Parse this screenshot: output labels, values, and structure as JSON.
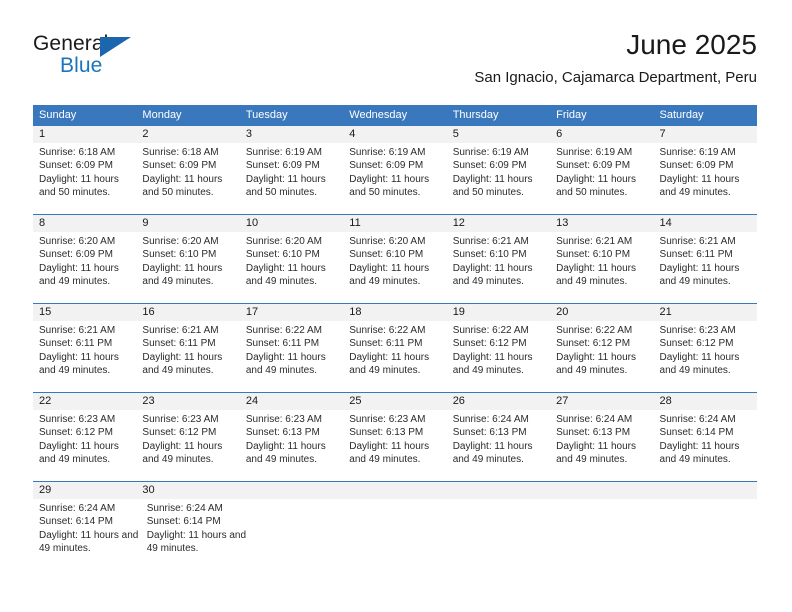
{
  "brand": {
    "name_part1": "General",
    "name_part2": "Blue",
    "flag_icon": "triangle-flag-icon",
    "accent_color": "#1c75bc"
  },
  "header": {
    "title": "June 2025",
    "subtitle": "San Ignacio, Cajamarca Department, Peru"
  },
  "theme": {
    "header_blue": "#3a78bd",
    "daynum_band_gray": "#f2f2f2",
    "text_color": "#1a1a1a"
  },
  "calendar": {
    "weekdays": [
      "Sunday",
      "Monday",
      "Tuesday",
      "Wednesday",
      "Thursday",
      "Friday",
      "Saturday"
    ],
    "weeks": [
      {
        "days": [
          {
            "num": "1",
            "sunrise": "Sunrise: 6:18 AM",
            "sunset": "Sunset: 6:09 PM",
            "daylight": "Daylight: 11 hours and 50 minutes."
          },
          {
            "num": "2",
            "sunrise": "Sunrise: 6:18 AM",
            "sunset": "Sunset: 6:09 PM",
            "daylight": "Daylight: 11 hours and 50 minutes."
          },
          {
            "num": "3",
            "sunrise": "Sunrise: 6:19 AM",
            "sunset": "Sunset: 6:09 PM",
            "daylight": "Daylight: 11 hours and 50 minutes."
          },
          {
            "num": "4",
            "sunrise": "Sunrise: 6:19 AM",
            "sunset": "Sunset: 6:09 PM",
            "daylight": "Daylight: 11 hours and 50 minutes."
          },
          {
            "num": "5",
            "sunrise": "Sunrise: 6:19 AM",
            "sunset": "Sunset: 6:09 PM",
            "daylight": "Daylight: 11 hours and 50 minutes."
          },
          {
            "num": "6",
            "sunrise": "Sunrise: 6:19 AM",
            "sunset": "Sunset: 6:09 PM",
            "daylight": "Daylight: 11 hours and 50 minutes."
          },
          {
            "num": "7",
            "sunrise": "Sunrise: 6:19 AM",
            "sunset": "Sunset: 6:09 PM",
            "daylight": "Daylight: 11 hours and 49 minutes."
          }
        ]
      },
      {
        "days": [
          {
            "num": "8",
            "sunrise": "Sunrise: 6:20 AM",
            "sunset": "Sunset: 6:09 PM",
            "daylight": "Daylight: 11 hours and 49 minutes."
          },
          {
            "num": "9",
            "sunrise": "Sunrise: 6:20 AM",
            "sunset": "Sunset: 6:10 PM",
            "daylight": "Daylight: 11 hours and 49 minutes."
          },
          {
            "num": "10",
            "sunrise": "Sunrise: 6:20 AM",
            "sunset": "Sunset: 6:10 PM",
            "daylight": "Daylight: 11 hours and 49 minutes."
          },
          {
            "num": "11",
            "sunrise": "Sunrise: 6:20 AM",
            "sunset": "Sunset: 6:10 PM",
            "daylight": "Daylight: 11 hours and 49 minutes."
          },
          {
            "num": "12",
            "sunrise": "Sunrise: 6:21 AM",
            "sunset": "Sunset: 6:10 PM",
            "daylight": "Daylight: 11 hours and 49 minutes."
          },
          {
            "num": "13",
            "sunrise": "Sunrise: 6:21 AM",
            "sunset": "Sunset: 6:10 PM",
            "daylight": "Daylight: 11 hours and 49 minutes."
          },
          {
            "num": "14",
            "sunrise": "Sunrise: 6:21 AM",
            "sunset": "Sunset: 6:11 PM",
            "daylight": "Daylight: 11 hours and 49 minutes."
          }
        ]
      },
      {
        "days": [
          {
            "num": "15",
            "sunrise": "Sunrise: 6:21 AM",
            "sunset": "Sunset: 6:11 PM",
            "daylight": "Daylight: 11 hours and 49 minutes."
          },
          {
            "num": "16",
            "sunrise": "Sunrise: 6:21 AM",
            "sunset": "Sunset: 6:11 PM",
            "daylight": "Daylight: 11 hours and 49 minutes."
          },
          {
            "num": "17",
            "sunrise": "Sunrise: 6:22 AM",
            "sunset": "Sunset: 6:11 PM",
            "daylight": "Daylight: 11 hours and 49 minutes."
          },
          {
            "num": "18",
            "sunrise": "Sunrise: 6:22 AM",
            "sunset": "Sunset: 6:11 PM",
            "daylight": "Daylight: 11 hours and 49 minutes."
          },
          {
            "num": "19",
            "sunrise": "Sunrise: 6:22 AM",
            "sunset": "Sunset: 6:12 PM",
            "daylight": "Daylight: 11 hours and 49 minutes."
          },
          {
            "num": "20",
            "sunrise": "Sunrise: 6:22 AM",
            "sunset": "Sunset: 6:12 PM",
            "daylight": "Daylight: 11 hours and 49 minutes."
          },
          {
            "num": "21",
            "sunrise": "Sunrise: 6:23 AM",
            "sunset": "Sunset: 6:12 PM",
            "daylight": "Daylight: 11 hours and 49 minutes."
          }
        ]
      },
      {
        "days": [
          {
            "num": "22",
            "sunrise": "Sunrise: 6:23 AM",
            "sunset": "Sunset: 6:12 PM",
            "daylight": "Daylight: 11 hours and 49 minutes."
          },
          {
            "num": "23",
            "sunrise": "Sunrise: 6:23 AM",
            "sunset": "Sunset: 6:12 PM",
            "daylight": "Daylight: 11 hours and 49 minutes."
          },
          {
            "num": "24",
            "sunrise": "Sunrise: 6:23 AM",
            "sunset": "Sunset: 6:13 PM",
            "daylight": "Daylight: 11 hours and 49 minutes."
          },
          {
            "num": "25",
            "sunrise": "Sunrise: 6:23 AM",
            "sunset": "Sunset: 6:13 PM",
            "daylight": "Daylight: 11 hours and 49 minutes."
          },
          {
            "num": "26",
            "sunrise": "Sunrise: 6:24 AM",
            "sunset": "Sunset: 6:13 PM",
            "daylight": "Daylight: 11 hours and 49 minutes."
          },
          {
            "num": "27",
            "sunrise": "Sunrise: 6:24 AM",
            "sunset": "Sunset: 6:13 PM",
            "daylight": "Daylight: 11 hours and 49 minutes."
          },
          {
            "num": "28",
            "sunrise": "Sunrise: 6:24 AM",
            "sunset": "Sunset: 6:14 PM",
            "daylight": "Daylight: 11 hours and 49 minutes."
          }
        ]
      },
      {
        "days": [
          {
            "num": "29",
            "sunrise": "Sunrise: 6:24 AM",
            "sunset": "Sunset: 6:14 PM",
            "daylight": "Daylight: 11 hours and 49 minutes."
          },
          {
            "num": "30",
            "sunrise": "Sunrise: 6:24 AM",
            "sunset": "Sunset: 6:14 PM",
            "daylight": "Daylight: 11 hours and 49 minutes."
          },
          {
            "num": "",
            "sunrise": "",
            "sunset": "",
            "daylight": ""
          },
          {
            "num": "",
            "sunrise": "",
            "sunset": "",
            "daylight": ""
          },
          {
            "num": "",
            "sunrise": "",
            "sunset": "",
            "daylight": ""
          },
          {
            "num": "",
            "sunrise": "",
            "sunset": "",
            "daylight": ""
          },
          {
            "num": "",
            "sunrise": "",
            "sunset": "",
            "daylight": ""
          }
        ]
      }
    ]
  }
}
